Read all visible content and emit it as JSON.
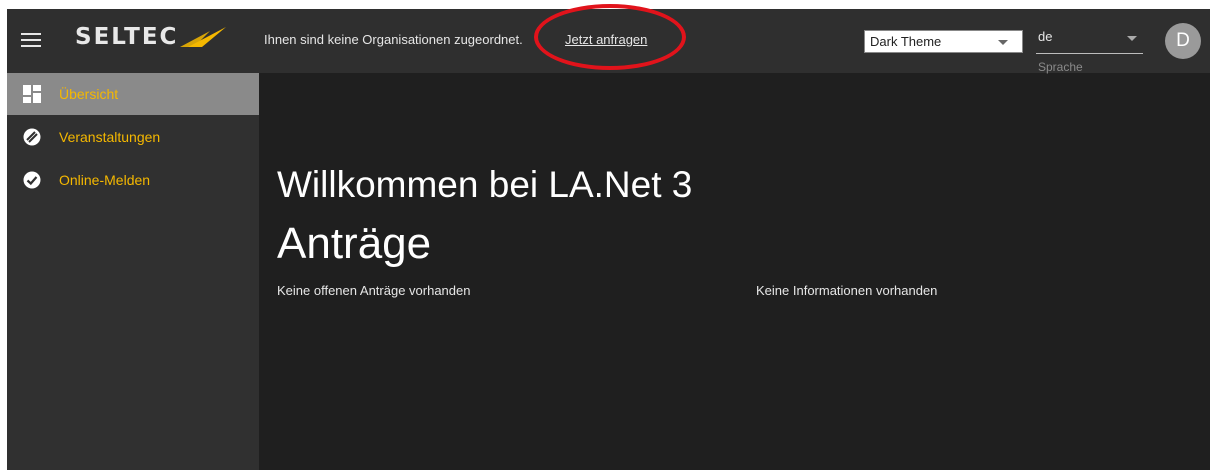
{
  "header": {
    "logo_text": "SELTEC",
    "notice": "Ihnen sind keine Organisationen zugeordnet.",
    "request_link": "Jetzt anfragen",
    "theme_select": {
      "value": "Dark Theme"
    },
    "language_select": {
      "value": "de",
      "label": "Sprache"
    },
    "avatar_initial": "D"
  },
  "sidebar": {
    "items": [
      {
        "label": "Übersicht",
        "icon": "dashboard-icon",
        "active": true
      },
      {
        "label": "Veranstaltungen",
        "icon": "event-icon",
        "active": false
      },
      {
        "label": "Online-Melden",
        "icon": "check-circle-icon",
        "active": false
      }
    ]
  },
  "main": {
    "welcome": "Willkommen bei LA.Net 3",
    "section_title": "Anträge",
    "requests_empty": "Keine offenen Anträge vorhanden",
    "info_empty": "Keine Informationen vorhanden"
  },
  "colors": {
    "accent": "#f5b800",
    "topbar": "#2f2f2f",
    "sidebar": "#303030",
    "content_bg": "#1f1f1f",
    "highlight": "#e1131b"
  }
}
